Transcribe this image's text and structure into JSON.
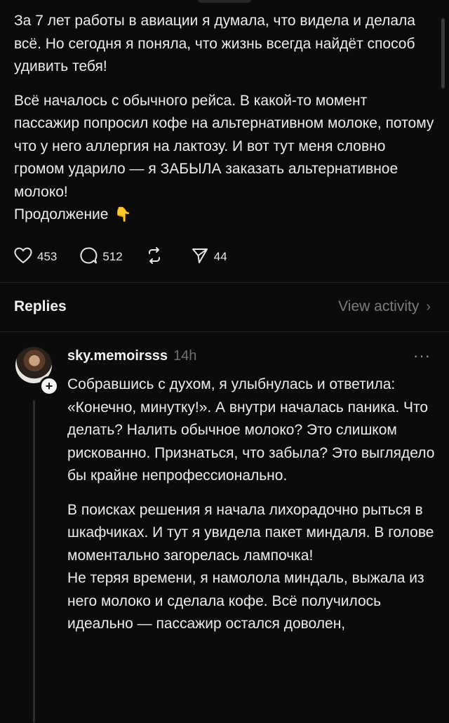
{
  "post": {
    "paragraph1": "За 7 лет работы в авиации я думала, что видела и делала всё. Но сегодня я поняла, что жизнь всегда найдёт способ удивить тебя!",
    "paragraph2": "Всё началось с обычного рейса. В какой-то момент пассажир попросил кофе на альтернативном молоке, потому что у него аллергия на лактозу. И вот тут меня словно громом ударило — я ЗАБЫЛА заказать альтернативное молоко!",
    "continuation": "Продолжение",
    "continuation_emoji": "👇",
    "likes": "453",
    "comments": "512",
    "shares": "44"
  },
  "replies_header": {
    "title": "Replies",
    "view_activity": "View activity",
    "chevron": "›"
  },
  "reply": {
    "username": "sky.memoirsss",
    "time": "14h",
    "more": "···",
    "follow_plus": "+",
    "paragraph1": "Собравшись с духом, я улыбнулась и ответила: «Конечно, минутку!». А внутри началась паника. Что делать? Налить обычное молоко? Это слишком рискованно. Признаться, что забыла? Это выглядело бы крайне непрофессионально.",
    "paragraph2": "В поисках решения я начала лихорадочно рыться в шкафчиках. И тут я увидела пакет миндаля. В голове моментально загорелась лампочка!",
    "paragraph3": "Не теряя времени, я намолола миндаль, выжала из него молоко и сделала кофе. Всё получилось идеально — пассажир остался доволен,"
  },
  "icons": {
    "like": "heart-icon",
    "comment": "comment-bubble-icon",
    "repost": "repost-icon",
    "share": "send-icon"
  },
  "colors": {
    "background": "#0b0b0b",
    "text": "#ececec",
    "muted": "#7c7c7c"
  }
}
